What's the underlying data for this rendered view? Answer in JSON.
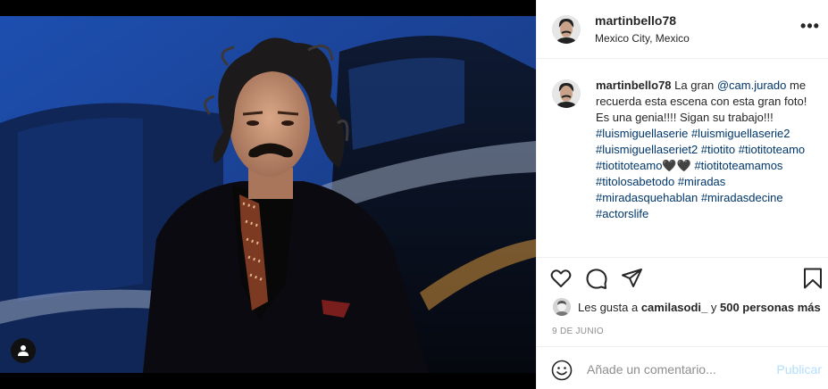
{
  "post": {
    "username": "martinbello78",
    "location": "Mexico City, Mexico",
    "more_label": "•••"
  },
  "caption": {
    "username": "martinbello78",
    "intro": " La gran ",
    "mention": "@cam.jurado",
    "body": " me recuerda esta escena con esta gran foto! Es una genia!!!! Sigan su trabajo!!! ",
    "hashtags": [
      "#luismiguellaserie",
      "#luismiguellaserie2",
      "#luismiguellaseriet2",
      "#tiotito",
      "#tiotitoteamo",
      "#tiotitoteamo🖤🖤",
      "#tiotitoteamamos",
      "#titolosabetodo",
      "#miradas",
      "#miradasquehablan",
      "#miradasdecine",
      "#actorslife"
    ]
  },
  "likes": {
    "prefix": "Les gusta a ",
    "user": "camilasodi_",
    "middle": " y ",
    "count_text": "500 personas más"
  },
  "date": "9 DE JUNIO",
  "comment": {
    "placeholder": "Añade un comentario...",
    "publish_label": "Publicar"
  },
  "icons": {
    "like": "heart-icon",
    "comment": "speech-bubble-icon",
    "share": "paper-plane-icon",
    "save": "bookmark-icon",
    "emoji": "smiley-icon",
    "tagged": "user-silhouette-icon"
  },
  "colors": {
    "link": "#00376b",
    "muted": "#8e8e8e",
    "publish_disabled": "#b2dffc",
    "divider": "#efefef"
  }
}
